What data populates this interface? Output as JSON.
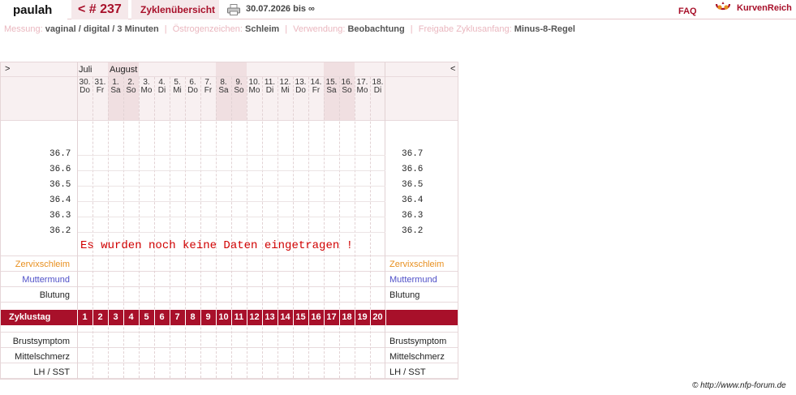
{
  "header": {
    "user": "paulah",
    "cycle": "< # 237",
    "overview": "Zyklenübersicht",
    "date_range": "30.07.2026 bis ∞",
    "faq": "FAQ",
    "logo_text": "KurvenReich"
  },
  "info": {
    "measurement_label": "Messung:",
    "measurement_value": "vaginal / digital / 3 Minuten",
    "estrogen_label": "Östrogenzeichen:",
    "estrogen_value": "Schleim",
    "usage_label": "Verwendung:",
    "usage_value": "Beobachtung",
    "release_label": "Freigabe Zyklusanfang:",
    "release_value": "Minus-8-Regel"
  },
  "chart": {
    "nav_next": ">",
    "nav_prev": "<",
    "months": [
      "Juli",
      "August"
    ],
    "days": [
      {
        "num": "30.",
        "name": "Do",
        "weekend": false
      },
      {
        "num": "31.",
        "name": "Fr",
        "weekend": false
      },
      {
        "num": "1.",
        "name": "Sa",
        "weekend": true
      },
      {
        "num": "2.",
        "name": "So",
        "weekend": true
      },
      {
        "num": "3.",
        "name": "Mo",
        "weekend": false
      },
      {
        "num": "4.",
        "name": "Di",
        "weekend": false
      },
      {
        "num": "5.",
        "name": "Mi",
        "weekend": false
      },
      {
        "num": "6.",
        "name": "Do",
        "weekend": false
      },
      {
        "num": "7.",
        "name": "Fr",
        "weekend": false
      },
      {
        "num": "8.",
        "name": "Sa",
        "weekend": true
      },
      {
        "num": "9.",
        "name": "So",
        "weekend": true
      },
      {
        "num": "10.",
        "name": "Mo",
        "weekend": false
      },
      {
        "num": "11.",
        "name": "Di",
        "weekend": false
      },
      {
        "num": "12.",
        "name": "Mi",
        "weekend": false
      },
      {
        "num": "13.",
        "name": "Do",
        "weekend": false
      },
      {
        "num": "14.",
        "name": "Fr",
        "weekend": false
      },
      {
        "num": "15.",
        "name": "Sa",
        "weekend": true
      },
      {
        "num": "16.",
        "name": "So",
        "weekend": true
      },
      {
        "num": "17.",
        "name": "Mo",
        "weekend": false
      },
      {
        "num": "18.",
        "name": "Di",
        "weekend": false
      }
    ],
    "temperatures": [
      "36.7",
      "36.6",
      "36.5",
      "36.4",
      "36.3",
      "36.2"
    ],
    "no_data": "Es wurden noch keine Daten eingetragen !",
    "row_cervix": "Zervixschleim",
    "row_cervix_color": "#e89020",
    "row_cervix_pos": "Muttermund",
    "row_cervix_pos_color": "#5050c8",
    "row_bleeding": "Blutung",
    "cycle_day_label": "Zyklustag",
    "cycle_days": [
      "1",
      "2",
      "3",
      "4",
      "5",
      "6",
      "7",
      "8",
      "9",
      "10",
      "11",
      "12",
      "13",
      "14",
      "15",
      "16",
      "17",
      "18",
      "19",
      "20"
    ],
    "cycle_bar_color": "#a8102a",
    "row_breast": "Brustsymptom",
    "row_midpain": "Mittelschmerz",
    "row_lh": "LH / SST"
  },
  "footer": {
    "copyright": "© http://www.nfp-forum.de"
  }
}
